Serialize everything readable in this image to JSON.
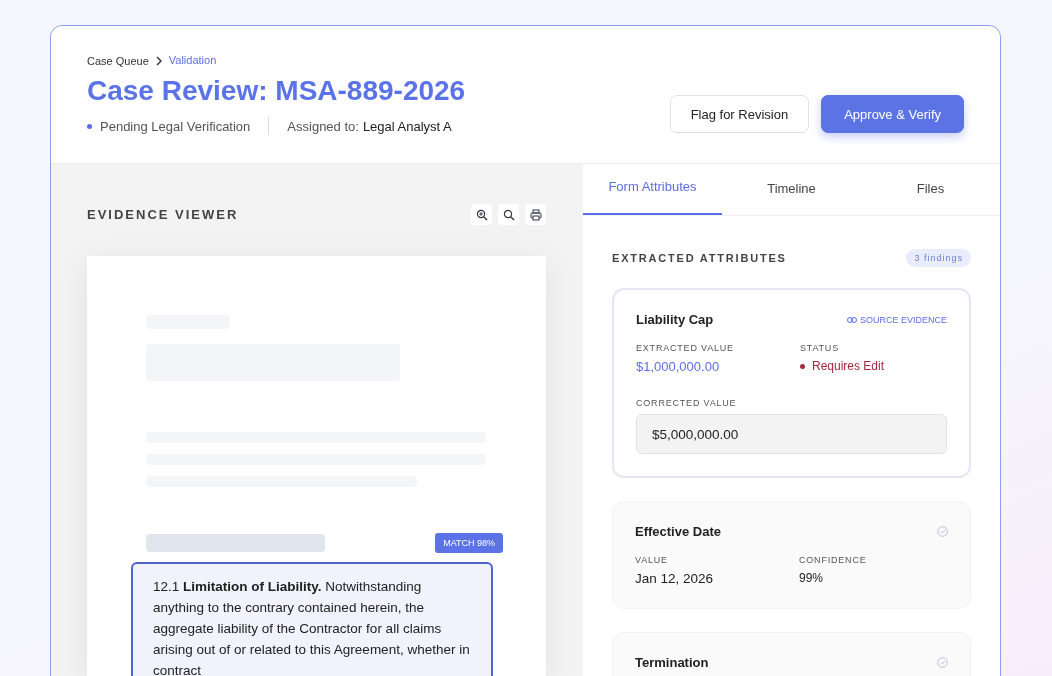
{
  "breadcrumb": [
    {
      "label": "Case Queue",
      "current": false
    },
    {
      "label": "Validation",
      "current": true
    }
  ],
  "title": "Case Review: MSA-889-2026",
  "status": "Pending Legal Verification",
  "assigned_label": "Assigned to:",
  "assignee": "Legal Analyst A",
  "buttons": [
    {
      "label": "Flag for Revision",
      "kind": "secondary"
    },
    {
      "label": "Approve & Verify",
      "kind": "primary"
    }
  ],
  "viewer": {
    "title": "EVIDENCE VIEWER",
    "match": "MATCH 98%",
    "clause": "12.1 **Limitation of Liability.** Notwithstanding anything to the contrary contained herein, the aggregate liability of the Contractor for all claims arising out of or related to this Agreement, whether in contract"
  },
  "tabs": [
    {
      "label": "Form Attributes",
      "selected": true
    },
    {
      "label": "Timeline",
      "selected": false
    },
    {
      "label": "Files",
      "selected": false
    }
  ],
  "section_title": "EXTRACTED ATTRIBUTES",
  "findings": "3 findings",
  "attributes": [
    {
      "kind": "edit",
      "title": "Liability Cap",
      "link": "SOURCE EVIDENCE",
      "fields": [
        {
          "label": "EXTRACTED VALUE",
          "value": "$1,000,000.00",
          "kind": "accent"
        },
        {
          "label": "STATUS",
          "value": "Requires Edit",
          "kind": "status"
        }
      ],
      "corrected_label": "CORRECTED VALUE",
      "corrected_value": "$5,000,000.00"
    },
    {
      "kind": "verified",
      "title": "Effective Date",
      "fields": [
        {
          "label": "VALUE",
          "value": "Jan 12, 2026",
          "kind": "large"
        },
        {
          "label": "CONFIDENCE",
          "value": "99%",
          "kind": "plain"
        }
      ]
    },
    {
      "kind": "verified",
      "title": "Termination"
    }
  ]
}
